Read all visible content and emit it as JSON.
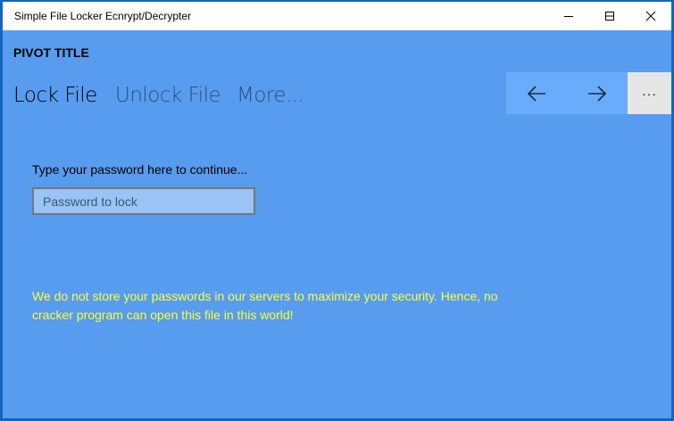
{
  "window": {
    "title": "Simple File Locker Ecnrypt/Decrypter"
  },
  "pivot": {
    "title": "PIVOT TITLE",
    "tabs": [
      {
        "label": "Lock File",
        "selected": true
      },
      {
        "label": "Unlock File",
        "selected": false
      },
      {
        "label": "More...",
        "selected": false
      }
    ]
  },
  "commandbar": {
    "back_icon": "arrow-left-icon",
    "forward_icon": "arrow-right-icon",
    "more_label": "···"
  },
  "form": {
    "prompt": "Type your password here to continue...",
    "password_value": "",
    "password_placeholder": "Password to lock"
  },
  "notice": "We do not store your passwords in our servers to maximize your security. Hence, no cracker program can open this file in this world!",
  "colors": {
    "background": "#579cef",
    "notice": "#ffff33"
  }
}
